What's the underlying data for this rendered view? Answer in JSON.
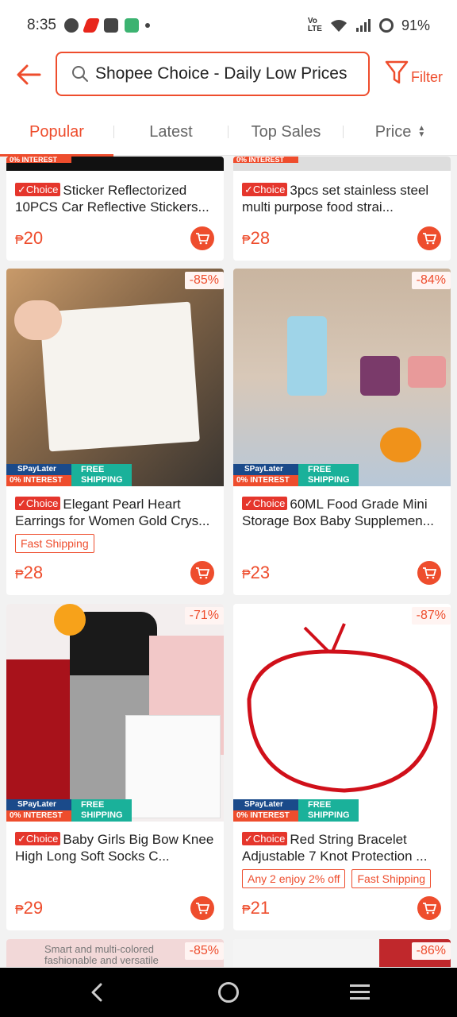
{
  "status": {
    "time": "8:35",
    "battery": "91%"
  },
  "search": {
    "query": "Shopee Choice - Daily Low Prices"
  },
  "filter_label": "Filter",
  "tabs": [
    {
      "label": "Popular",
      "active": true
    },
    {
      "label": "Latest"
    },
    {
      "label": "Top Sales"
    },
    {
      "label": "Price"
    }
  ],
  "choice_badge": "Choice",
  "promo": {
    "line1": "SPayLater",
    "line2": "0% INTEREST",
    "line3a": "FREE",
    "line3b": "SHIPPING"
  },
  "products": [
    {
      "title": "Sticker Reflectorized 10PCS Car Reflective Stickers...",
      "currency": "₱",
      "price": "20"
    },
    {
      "title": "3pcs set stainless steel multi purpose food strai...",
      "currency": "₱",
      "price": "28"
    },
    {
      "title": "Elegant Pearl Heart Earrings for Women Gold Crys...",
      "currency": "₱",
      "price": "28",
      "discount": "-85%",
      "tags": [
        "Fast Shipping"
      ]
    },
    {
      "title": "60ML Food Grade Mini Storage Box Baby Supplemen...",
      "currency": "₱",
      "price": "23",
      "discount": "-84%"
    },
    {
      "title": "Baby Girls Big Bow Knee High Long Soft Socks C...",
      "currency": "₱",
      "price": "29",
      "discount": "-71%"
    },
    {
      "title": "Red String Bracelet Adjustable 7 Knot Protection ...",
      "currency": "₱",
      "price": "21",
      "discount": "-87%",
      "tags": [
        "Any 2 enjoy 2% off",
        "Fast Shipping"
      ]
    },
    {
      "discount": "-85%",
      "overlay_text": "Smart and multi-colored fashionable and versatile"
    },
    {
      "discount": "-86%"
    }
  ],
  "colors": {
    "accent": "#ee4d2d",
    "choice": "#e5362c",
    "spaylater": "#1a4a8a",
    "freeship": "#1ab19a"
  }
}
